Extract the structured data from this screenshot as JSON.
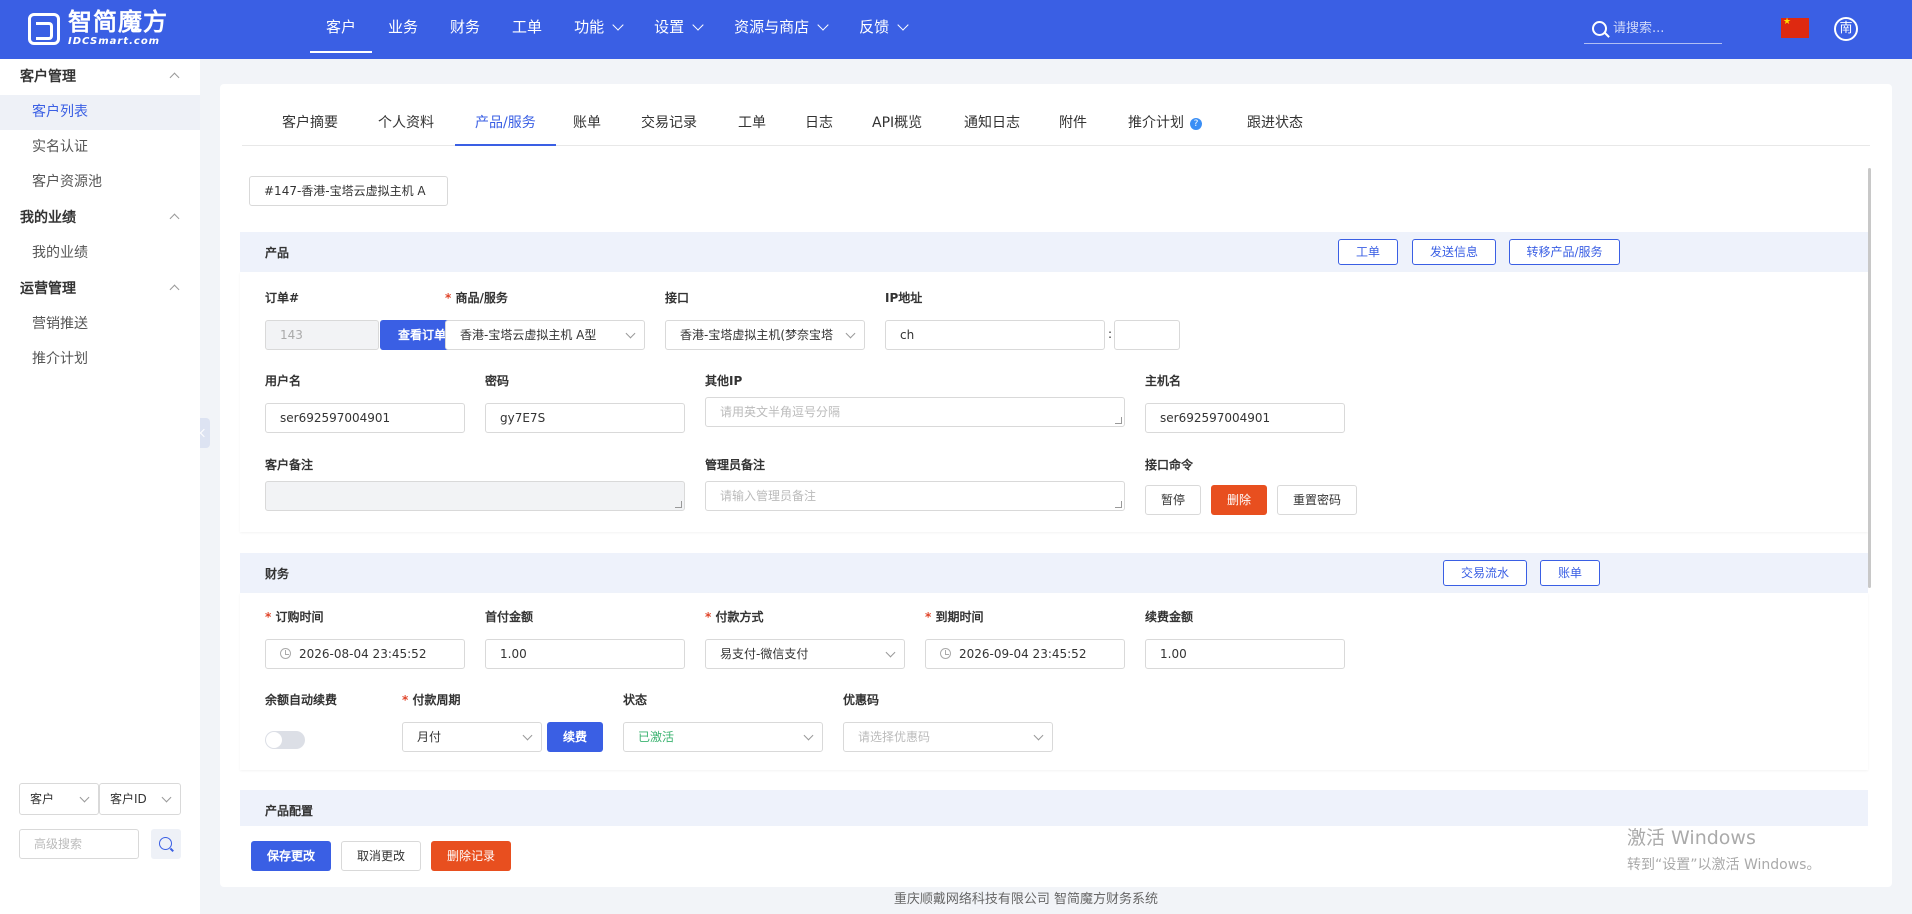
{
  "header": {
    "logo_cn": "智简魔方",
    "logo_en": "IDCSmart.com",
    "nav": [
      {
        "label": "客户",
        "active": true,
        "dropdown": false
      },
      {
        "label": "业务",
        "active": false,
        "dropdown": false
      },
      {
        "label": "财务",
        "active": false,
        "dropdown": false
      },
      {
        "label": "工单",
        "active": false,
        "dropdown": false
      },
      {
        "label": "功能",
        "active": false,
        "dropdown": true
      },
      {
        "label": "设置",
        "active": false,
        "dropdown": true
      },
      {
        "label": "资源与商店",
        "active": false,
        "dropdown": true
      },
      {
        "label": "反馈",
        "active": false,
        "dropdown": true
      }
    ],
    "search_placeholder": "请搜索...",
    "avatar_letter": "南"
  },
  "sidebar": {
    "groups": [
      {
        "title": "客户管理",
        "items": [
          "客户列表",
          "实名认证",
          "客户资源池"
        ]
      },
      {
        "title": "我的业绩",
        "items": [
          "我的业绩"
        ]
      },
      {
        "title": "运营管理",
        "items": [
          "营销推送",
          "推介计划"
        ]
      }
    ],
    "active_item": "客户列表",
    "filter_type": "客户",
    "filter_field": "客户ID",
    "advanced_search_placeholder": "高级搜索"
  },
  "tabs": [
    "客户摘要",
    "个人资料",
    "产品/服务",
    "账单",
    "交易记录",
    "工单",
    "日志",
    "API概览",
    "通知日志",
    "附件",
    "推介计划",
    "跟进状态"
  ],
  "active_tab": "产品/服务",
  "product_selector": "#147-香港-宝塔云虚拟主机 A",
  "product_section": {
    "title": "产品",
    "buttons": [
      "工单",
      "发送信息",
      "转移产品/服务"
    ],
    "order_label": "订单#",
    "order_value": "143",
    "view_order_button": "查看订单",
    "product_label": "商品/服务",
    "product_value": "香港-宝塔云虚拟主机 A型",
    "interface_label": "接口",
    "interface_value": "香港-宝塔虚拟主机(梦奈宝塔",
    "ip_label": "IP地址",
    "ip_value": "ch",
    "ip_colon": ":",
    "port_value": "",
    "username_label": "用户名",
    "username_value": "ser692597004901",
    "password_label": "密码",
    "password_value": "gy7E7S",
    "other_ip_label": "其他IP",
    "other_ip_placeholder": "请用英文半角逗号分隔",
    "hostname_label": "主机名",
    "hostname_value": "ser692597004901",
    "client_note_label": "客户备注",
    "admin_note_label": "管理员备注",
    "admin_note_placeholder": "请输入管理员备注",
    "command_label": "接口命令",
    "command_buttons": [
      "暂停",
      "删除",
      "重置密码"
    ]
  },
  "finance_section": {
    "title": "财务",
    "buttons": [
      "交易流水",
      "账单"
    ],
    "order_time_label": "订购时间",
    "order_time_value": "2026-08-04 23:45:52",
    "first_amount_label": "首付金额",
    "first_amount_value": "1.00",
    "payment_label": "付款方式",
    "payment_value": "易支付-微信支付",
    "expire_label": "到期时间",
    "expire_value": "2026-09-04 23:45:52",
    "renew_amount_label": "续费金额",
    "renew_amount_value": "1.00",
    "auto_renew_label": "余额自动续费",
    "auto_renew_on": false,
    "cycle_label": "付款周期",
    "cycle_value": "月付",
    "renew_button": "续费",
    "status_label": "状态",
    "status_value": "已激活",
    "coupon_label": "优惠码",
    "coupon_placeholder": "请选择优惠码"
  },
  "config_section": {
    "title": "产品配置"
  },
  "actions": {
    "save": "保存更改",
    "cancel": "取消更改",
    "delete": "删除记录"
  },
  "footer": "重庆顺戴网络科技有限公司 智简魔方财务系统",
  "watermark": {
    "line1": "激活 Windows",
    "line2": "转到“设置”以激活 Windows。"
  },
  "colors": {
    "primary": "#3a5fe4",
    "danger": "#e84f1f",
    "success": "#3cb371"
  }
}
